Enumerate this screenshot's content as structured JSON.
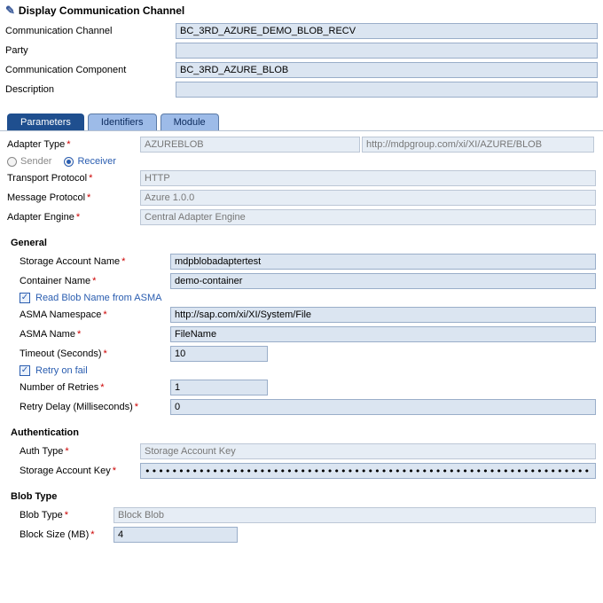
{
  "window": {
    "title": "Display Communication Channel"
  },
  "header": {
    "channel": {
      "label": "Communication Channel",
      "value": "BC_3RD_AZURE_DEMO_BLOB_RECV"
    },
    "party": {
      "label": "Party",
      "value": ""
    },
    "component": {
      "label": "Communication Component",
      "value": "BC_3RD_AZURE_BLOB"
    },
    "description": {
      "label": "Description",
      "value": ""
    }
  },
  "tabs": {
    "parameters": "Parameters",
    "identifiers": "Identifiers",
    "module": "Module"
  },
  "adapter": {
    "type_label": "Adapter Type",
    "type_value": "AZUREBLOB",
    "ns_value": "http://mdpgroup.com/xi/XI/AZURE/BLOB",
    "sender": "Sender",
    "receiver": "Receiver",
    "transport_label": "Transport Protocol",
    "transport_value": "HTTP",
    "message_label": "Message Protocol",
    "message_value": "Azure 1.0.0",
    "engine_label": "Adapter Engine",
    "engine_value": "Central Adapter Engine"
  },
  "general": {
    "title": "General",
    "storage_label": "Storage Account Name",
    "storage_value": "mdpblobadaptertest",
    "container_label": "Container Name",
    "container_value": "demo-container",
    "read_asma": "Read Blob Name from ASMA",
    "asma_ns_label": "ASMA Namespace",
    "asma_ns_value": "http://sap.com/xi/XI/System/File",
    "asma_name_label": "ASMA Name",
    "asma_name_value": "FileName",
    "timeout_label": "Timeout (Seconds)",
    "timeout_value": "10",
    "retry_label": "Retry on fail",
    "retries_label": "Number of Retries",
    "retries_value": "1",
    "delay_label": "Retry Delay (Milliseconds)",
    "delay_value": "0"
  },
  "auth": {
    "title": "Authentication",
    "type_label": "Auth Type",
    "type_value": "Storage Account Key",
    "key_label": "Storage Account Key",
    "key_value": "•••••••••••••••••••••••••••••••••••••••••••••••••••••••••••••••••••••••••••••••••••••••••"
  },
  "blob": {
    "title": "Blob Type",
    "type_label": "Blob Type",
    "type_value": "Block Blob",
    "size_label": "Block Size (MB)",
    "size_value": "4"
  }
}
